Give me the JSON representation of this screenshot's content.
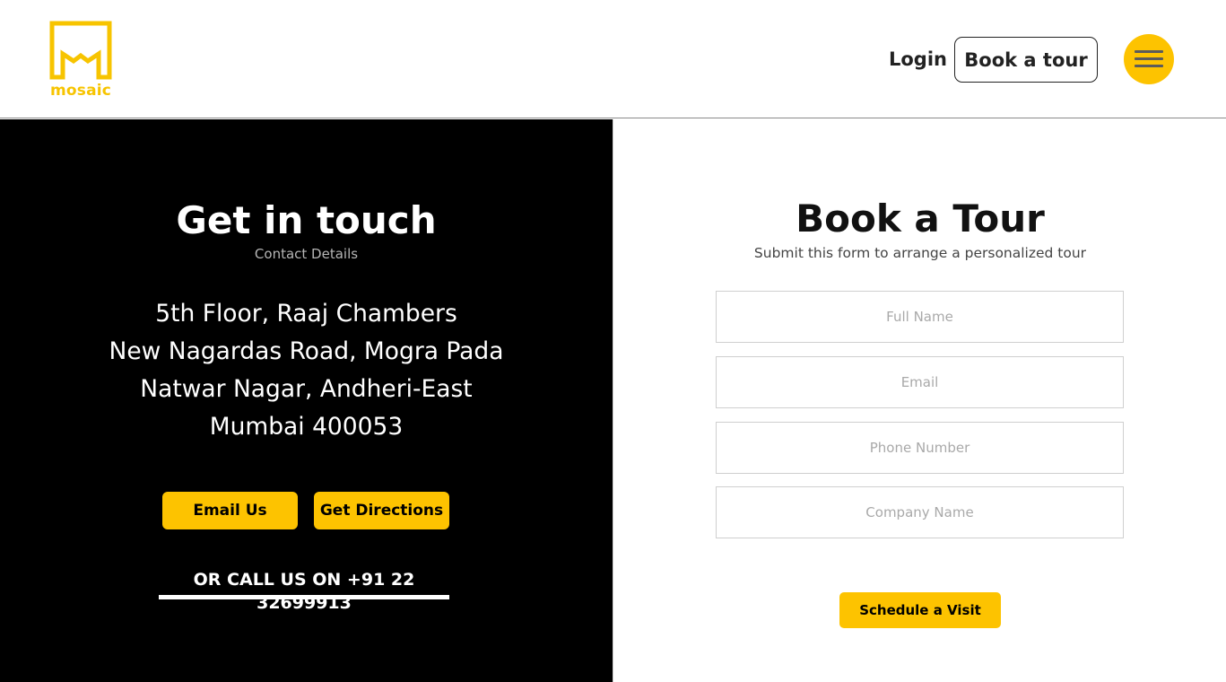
{
  "header": {
    "logo_text": "mosaic",
    "logo_icon": "mosaic-logo-icon",
    "login_label": "Login",
    "book_tour_label": "Book a tour",
    "menu_icon": "hamburger-icon"
  },
  "contact": {
    "title": "Get in touch",
    "subtitle": "Contact Details",
    "address_lines": [
      "5th Floor, Raaj Chambers",
      "New Nagardas Road, Mogra Pada",
      "Natwar Nagar, Andheri-East",
      "Mumbai 400053"
    ],
    "email_button": "Email Us",
    "directions_button": "Get Directions",
    "call_text": "OR CALL US ON +91 22 32699913"
  },
  "tour_form": {
    "title": "Book a Tour",
    "subtitle": "Submit this form to arrange a personalized tour",
    "full_name_placeholder": "Full Name",
    "email_placeholder": "Email",
    "phone_placeholder": "Phone Number",
    "company_placeholder": "Company Name",
    "submit_label": "Schedule a Visit"
  },
  "colors": {
    "accent": "#fdc300",
    "dark_panel": "#000000",
    "text": "#111111"
  }
}
